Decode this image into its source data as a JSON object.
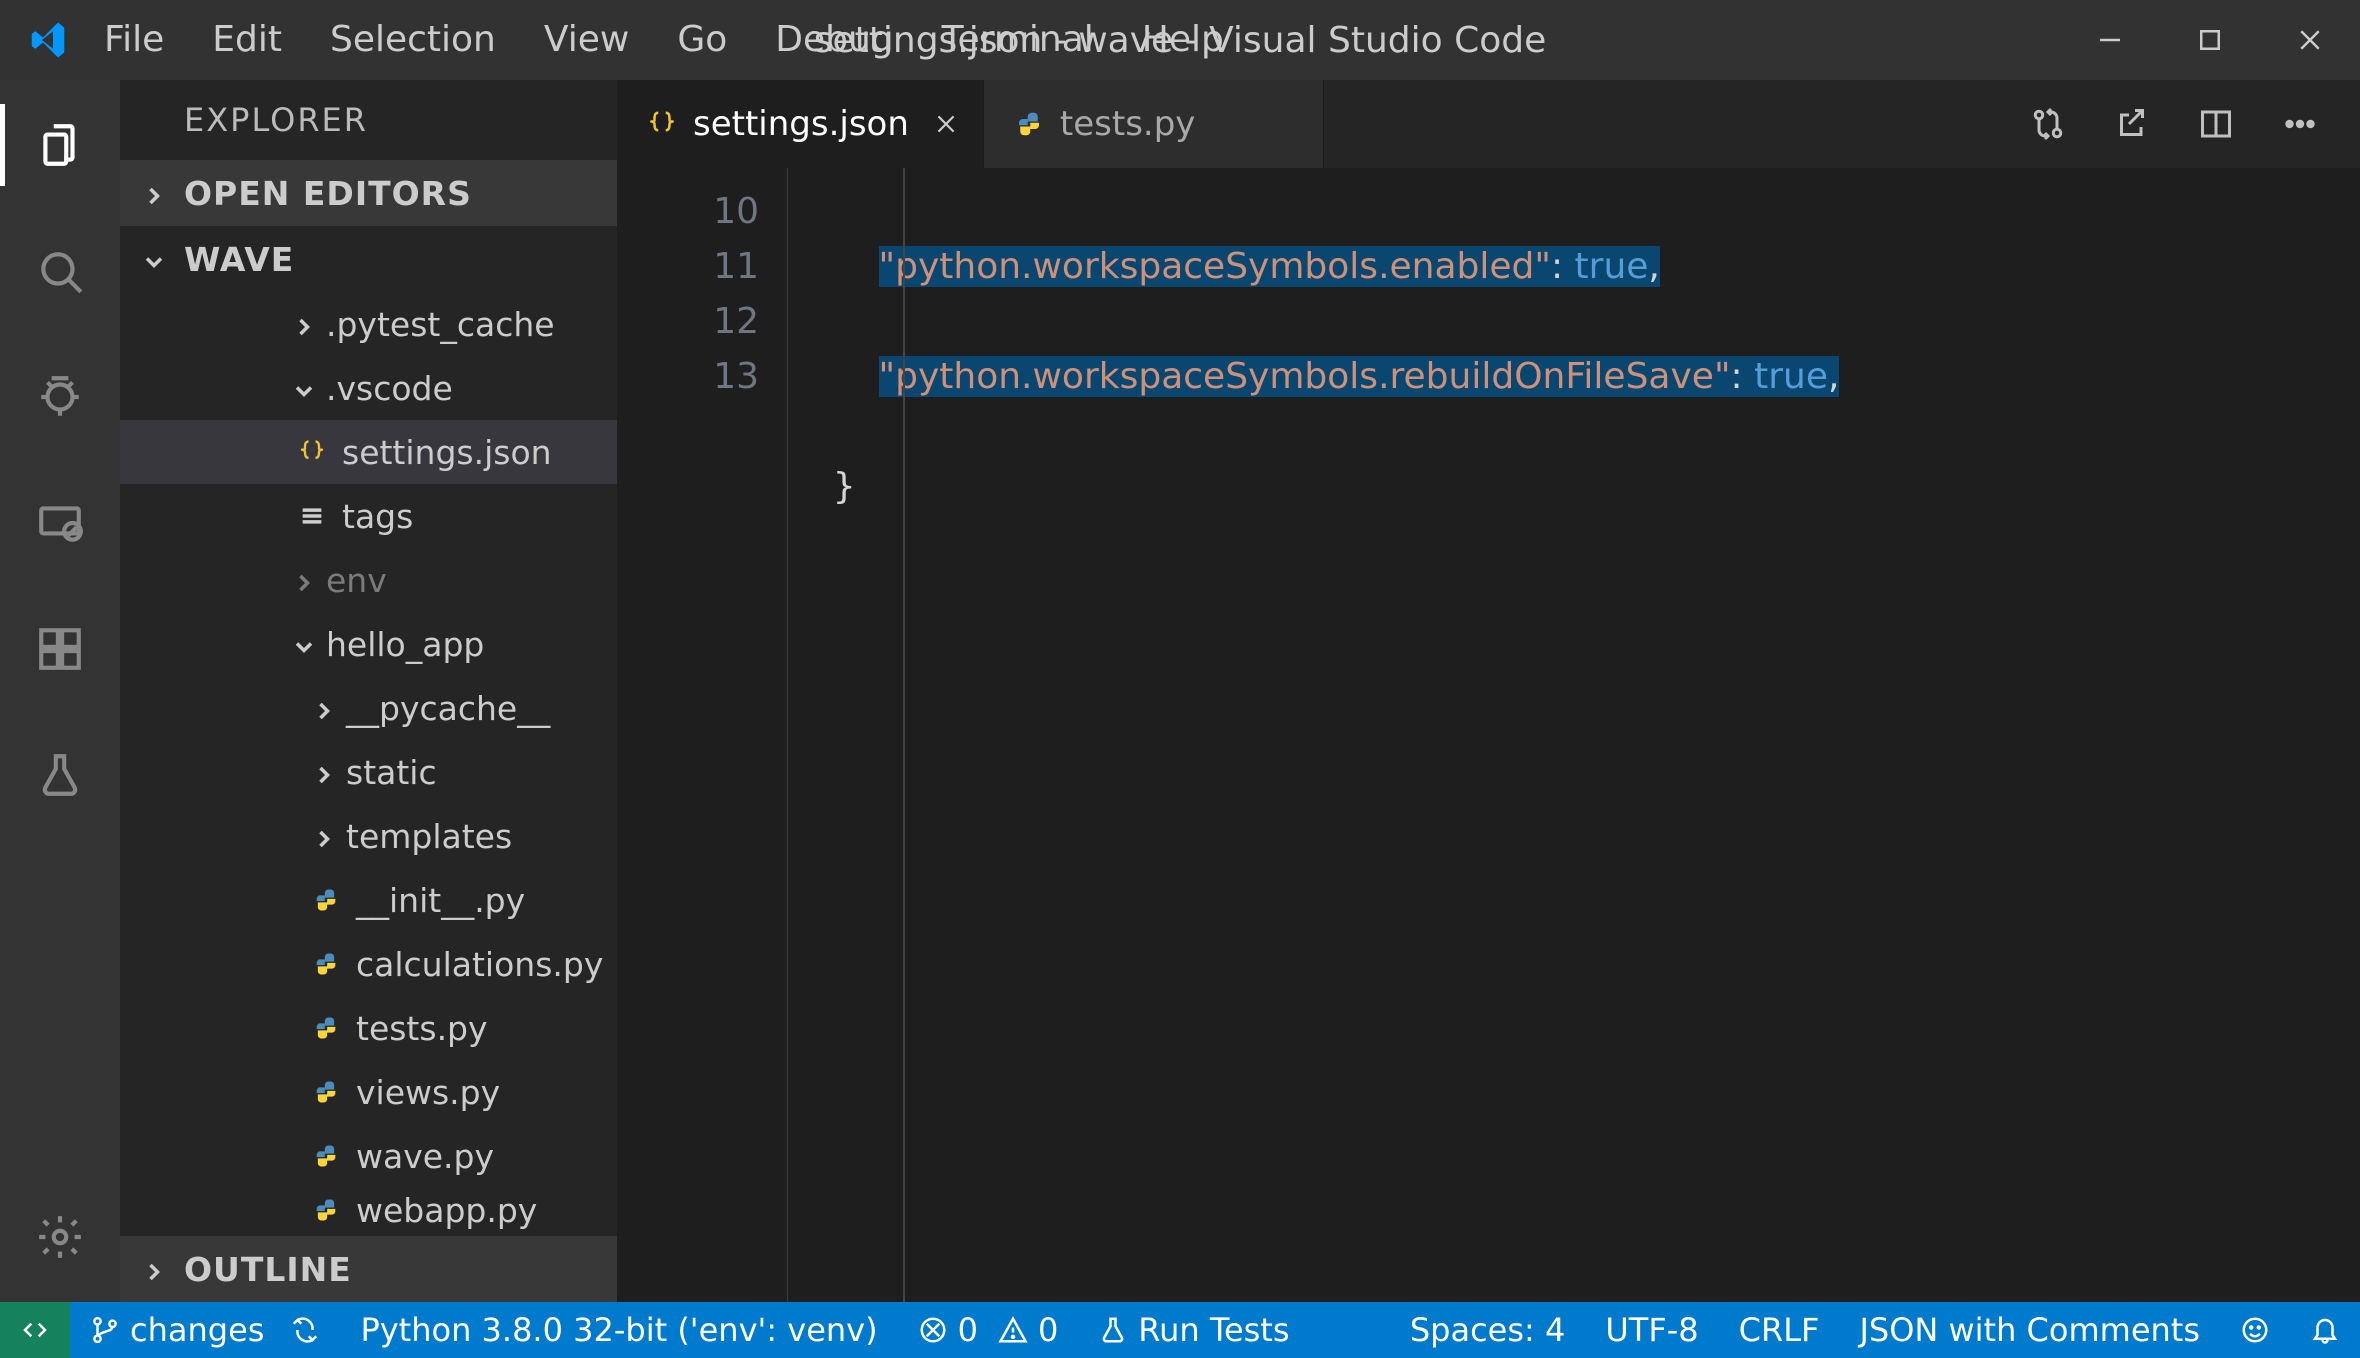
{
  "title": "settings.json - wave - Visual Studio Code",
  "menu": [
    "File",
    "Edit",
    "Selection",
    "View",
    "Go",
    "Debug",
    "Terminal",
    "Help"
  ],
  "sidebar": {
    "title": "EXPLORER",
    "sections": {
      "open_editors": "OPEN EDITORS",
      "workspace": "WAVE",
      "outline": "OUTLINE"
    },
    "tree": {
      "pytest_cache": ".pytest_cache",
      "vscode": ".vscode",
      "vscode_children": {
        "settings": "settings.json",
        "tags": "tags"
      },
      "env": "env",
      "hello_app": "hello_app",
      "hello_children": {
        "pycache": "__pycache__",
        "static": "static",
        "templates": "templates",
        "init": "__init__.py",
        "calculations": "calculations.py",
        "tests": "tests.py",
        "views": "views.py",
        "wave": "wave.py",
        "webapp": "webapp.py"
      }
    }
  },
  "tabs": {
    "settings": "settings.json",
    "tests": "tests.py"
  },
  "code": {
    "line_nums": {
      "l10": "10",
      "l11": "11",
      "l12": "12",
      "l13": "13"
    },
    "l10": {
      "key": "\"python.workspaceSymbols.enabled\"",
      "colon": ": ",
      "val": "true",
      "trail": ","
    },
    "l11": {
      "key": "\"python.workspaceSymbols.rebuildOnFileSave\"",
      "colon": ": ",
      "val": "true",
      "trail": ","
    },
    "l12": "    }",
    "l13": ""
  },
  "statusbar": {
    "branch": "changes",
    "python": "Python 3.8.0 32-bit ('env': venv)",
    "errors": "0",
    "warnings": "0",
    "run_tests": "Run Tests",
    "spaces": "Spaces: 4",
    "encoding": "UTF-8",
    "eol": "CRLF",
    "language": "JSON with Comments"
  },
  "colors": {
    "accent": "#007acc",
    "remote": "#16825d",
    "string": "#ce9178",
    "keyword": "#569cd6"
  }
}
